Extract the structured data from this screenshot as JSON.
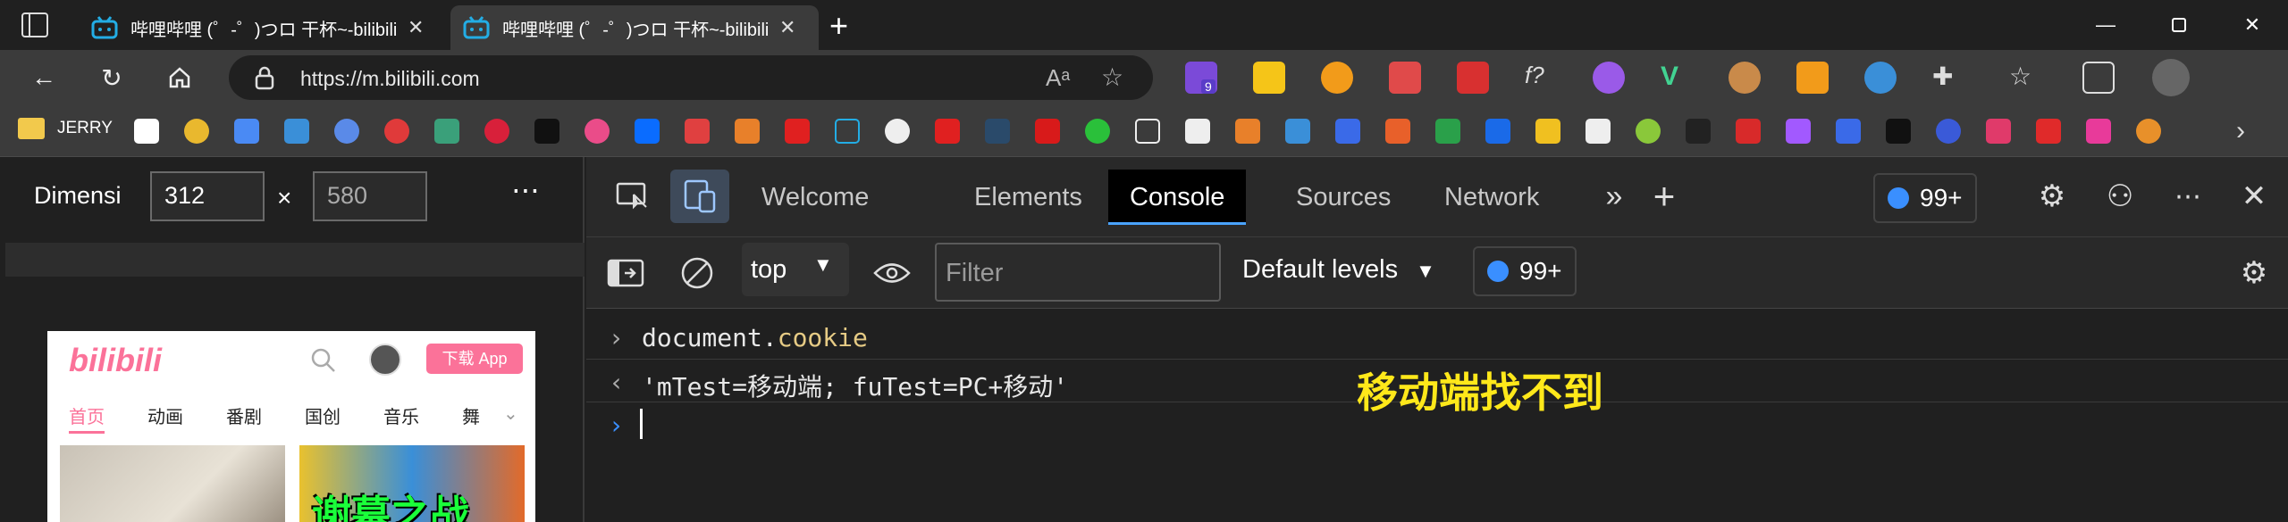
{
  "browser": {
    "tabs": [
      {
        "title": "哔哩哔哩 (゜-゜)つロ 干杯~-bilibili",
        "active": false
      },
      {
        "title": "哔哩哔哩 (゜-゜)つロ 干杯~-bilibili",
        "active": true
      }
    ],
    "url": "https://m.bilibili.com",
    "bookmark_folder": "JERRY",
    "extension_badge": "9",
    "window_controls": [
      "minimize",
      "maximize",
      "close"
    ]
  },
  "device_toolbar": {
    "label": "Dimensi",
    "width": "312",
    "height": "580",
    "times": "×",
    "more": "⋯"
  },
  "phone": {
    "logo": "bilibili",
    "download_label": "下载 App",
    "nav": [
      "首页",
      "动画",
      "番剧",
      "国创",
      "音乐",
      "舞"
    ],
    "thumb_text": "谢幕之战"
  },
  "devtools": {
    "tabs": [
      "Welcome",
      "Elements",
      "Console",
      "Sources",
      "Network"
    ],
    "active_tab": "Console",
    "issues_count": "99+",
    "context": "top",
    "filter_placeholder": "Filter",
    "levels": "Default levels",
    "toolbar_issues": "99+"
  },
  "console": {
    "input_obj": "document.",
    "input_prop": "cookie",
    "output": "'mTest=移动端; fuTest=PC+移动'",
    "annotation": "移动端找不到"
  },
  "colors": {
    "accent": "#4aa3ff",
    "bili_pink": "#fb7299",
    "annotation": "#ffe81a"
  }
}
